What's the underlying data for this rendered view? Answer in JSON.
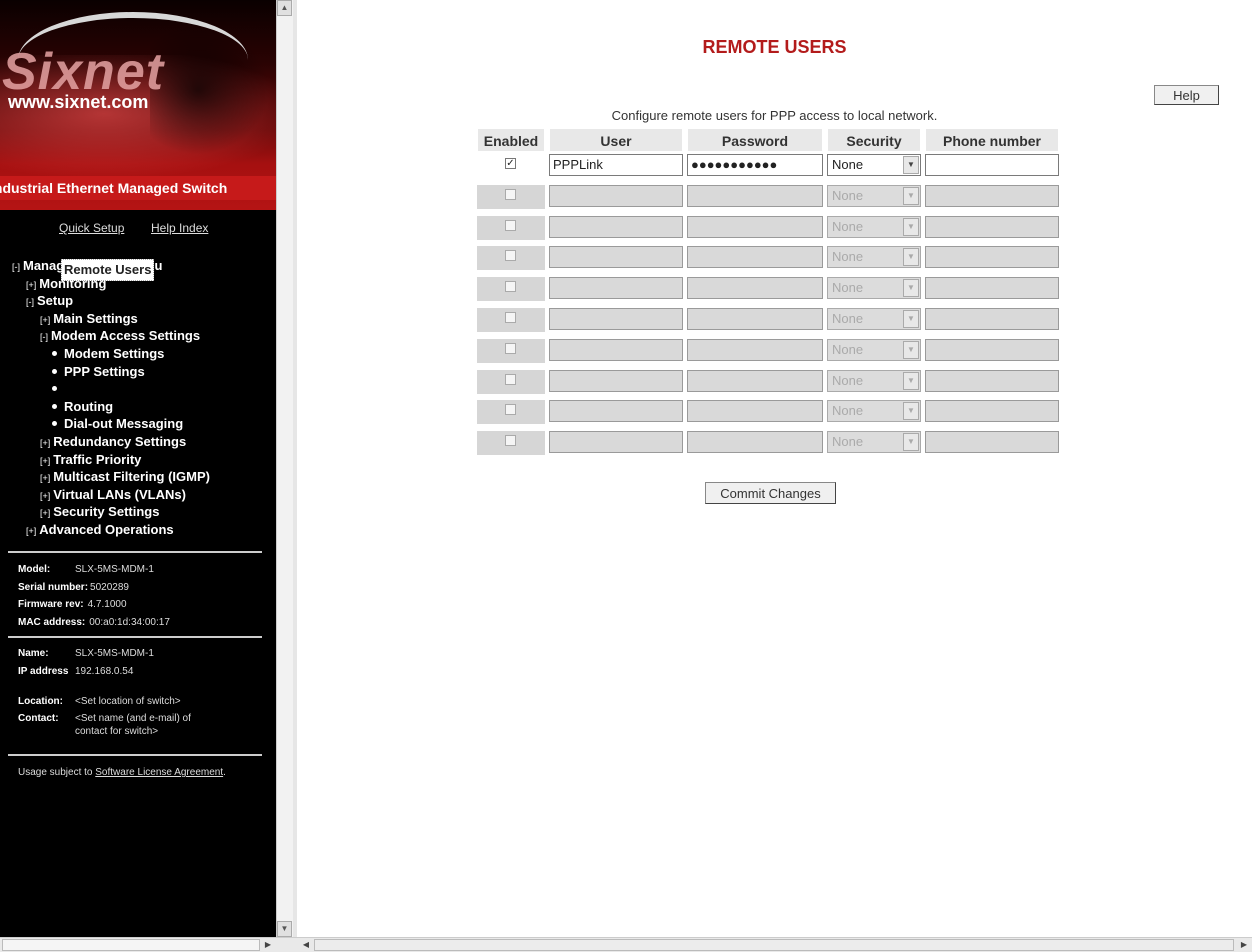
{
  "sidebar": {
    "brand": "Sixnet",
    "url": "www.sixnet.com",
    "banner": "Industrial Ethernet Managed Switch",
    "quick_setup": "Quick Setup",
    "help_index": "Help Index",
    "menu": [
      {
        "label": "Managed Switch Menu",
        "toggle": "[-]",
        "level": 0
      },
      {
        "label": "Monitoring",
        "toggle": "[+]",
        "level": 1
      },
      {
        "label": "Setup",
        "toggle": "[-]",
        "level": 1
      },
      {
        "label": "Main Settings",
        "toggle": "[+]",
        "level": 2
      },
      {
        "label": "Modem Access Settings",
        "toggle": "[-]",
        "level": 2
      },
      {
        "label": "Modem Settings",
        "toggle": "",
        "level": 3
      },
      {
        "label": "PPP Settings",
        "toggle": "",
        "level": 3
      },
      {
        "label": "Remote Users",
        "toggle": "",
        "level": 3,
        "selected": true
      },
      {
        "label": "Routing",
        "toggle": "",
        "level": 3
      },
      {
        "label": "Dial-out Messaging",
        "toggle": "",
        "level": 3
      },
      {
        "label": "Redundancy Settings",
        "toggle": "[+]",
        "level": 2
      },
      {
        "label": "Traffic Priority",
        "toggle": "[+]",
        "level": 2
      },
      {
        "label": "Multicast Filtering (IGMP)",
        "toggle": "[+]",
        "level": 2
      },
      {
        "label": "Virtual LANs (VLANs)",
        "toggle": "[+]",
        "level": 2
      },
      {
        "label": "Security Settings",
        "toggle": "[+]",
        "level": 2
      },
      {
        "label": "Advanced Operations",
        "toggle": "[+]",
        "level": 1
      }
    ],
    "device": {
      "model_label": "Model:",
      "model": "SLX-5MS-MDM-1",
      "serial_label": "Serial number:",
      "serial": "5020289",
      "firmware_label": "Firmware rev:",
      "firmware": "4.7.1000",
      "mac_label": "MAC address:",
      "mac": "00:a0:1d:34:00:17"
    },
    "location": {
      "name_label": "Name:",
      "name": "SLX-5MS-MDM-1",
      "ip_label": "IP address",
      "ip": "192.168.0.54",
      "location_label": "Location:",
      "location": "<Set location of switch>",
      "contact_label": "Contact:",
      "contact": "<Set name (and e-mail) of contact for switch>"
    },
    "usage_text": "Usage subject to ",
    "license_link": "Software License Agreement",
    "usage_end": "."
  },
  "main": {
    "title": "REMOTE USERS",
    "help_label": "Help",
    "description": "Configure remote users for PPP access to local network.",
    "columns": [
      "Enabled",
      "User",
      "Password",
      "Security",
      "Phone number"
    ],
    "rows": [
      {
        "enabled": true,
        "user": "PPPLink",
        "password": "●●●●●●●●●●●",
        "security": "None",
        "phone": "",
        "active": true
      },
      {
        "enabled": false,
        "user": "",
        "password": "",
        "security": "None",
        "phone": "",
        "active": false
      },
      {
        "enabled": false,
        "user": "",
        "password": "",
        "security": "None",
        "phone": "",
        "active": false
      },
      {
        "enabled": false,
        "user": "",
        "password": "",
        "security": "None",
        "phone": "",
        "active": false
      },
      {
        "enabled": false,
        "user": "",
        "password": "",
        "security": "None",
        "phone": "",
        "active": false
      },
      {
        "enabled": false,
        "user": "",
        "password": "",
        "security": "None",
        "phone": "",
        "active": false
      },
      {
        "enabled": false,
        "user": "",
        "password": "",
        "security": "None",
        "phone": "",
        "active": false
      },
      {
        "enabled": false,
        "user": "",
        "password": "",
        "security": "None",
        "phone": "",
        "active": false
      },
      {
        "enabled": false,
        "user": "",
        "password": "",
        "security": "None",
        "phone": "",
        "active": false
      },
      {
        "enabled": false,
        "user": "",
        "password": "",
        "security": "None",
        "phone": "",
        "active": false
      }
    ],
    "commit_label": "Commit Changes"
  },
  "icons": {
    "scroll_up": "▲",
    "scroll_down": "▼",
    "scroll_left": "◀",
    "scroll_right": "▶",
    "dropdown": "▼",
    "checkmark": "✓",
    "bullet": "•"
  },
  "colors": {
    "title_red": "#b31b1b",
    "banner_red": "#c61a1a",
    "sidebar_bg": "#000000"
  }
}
